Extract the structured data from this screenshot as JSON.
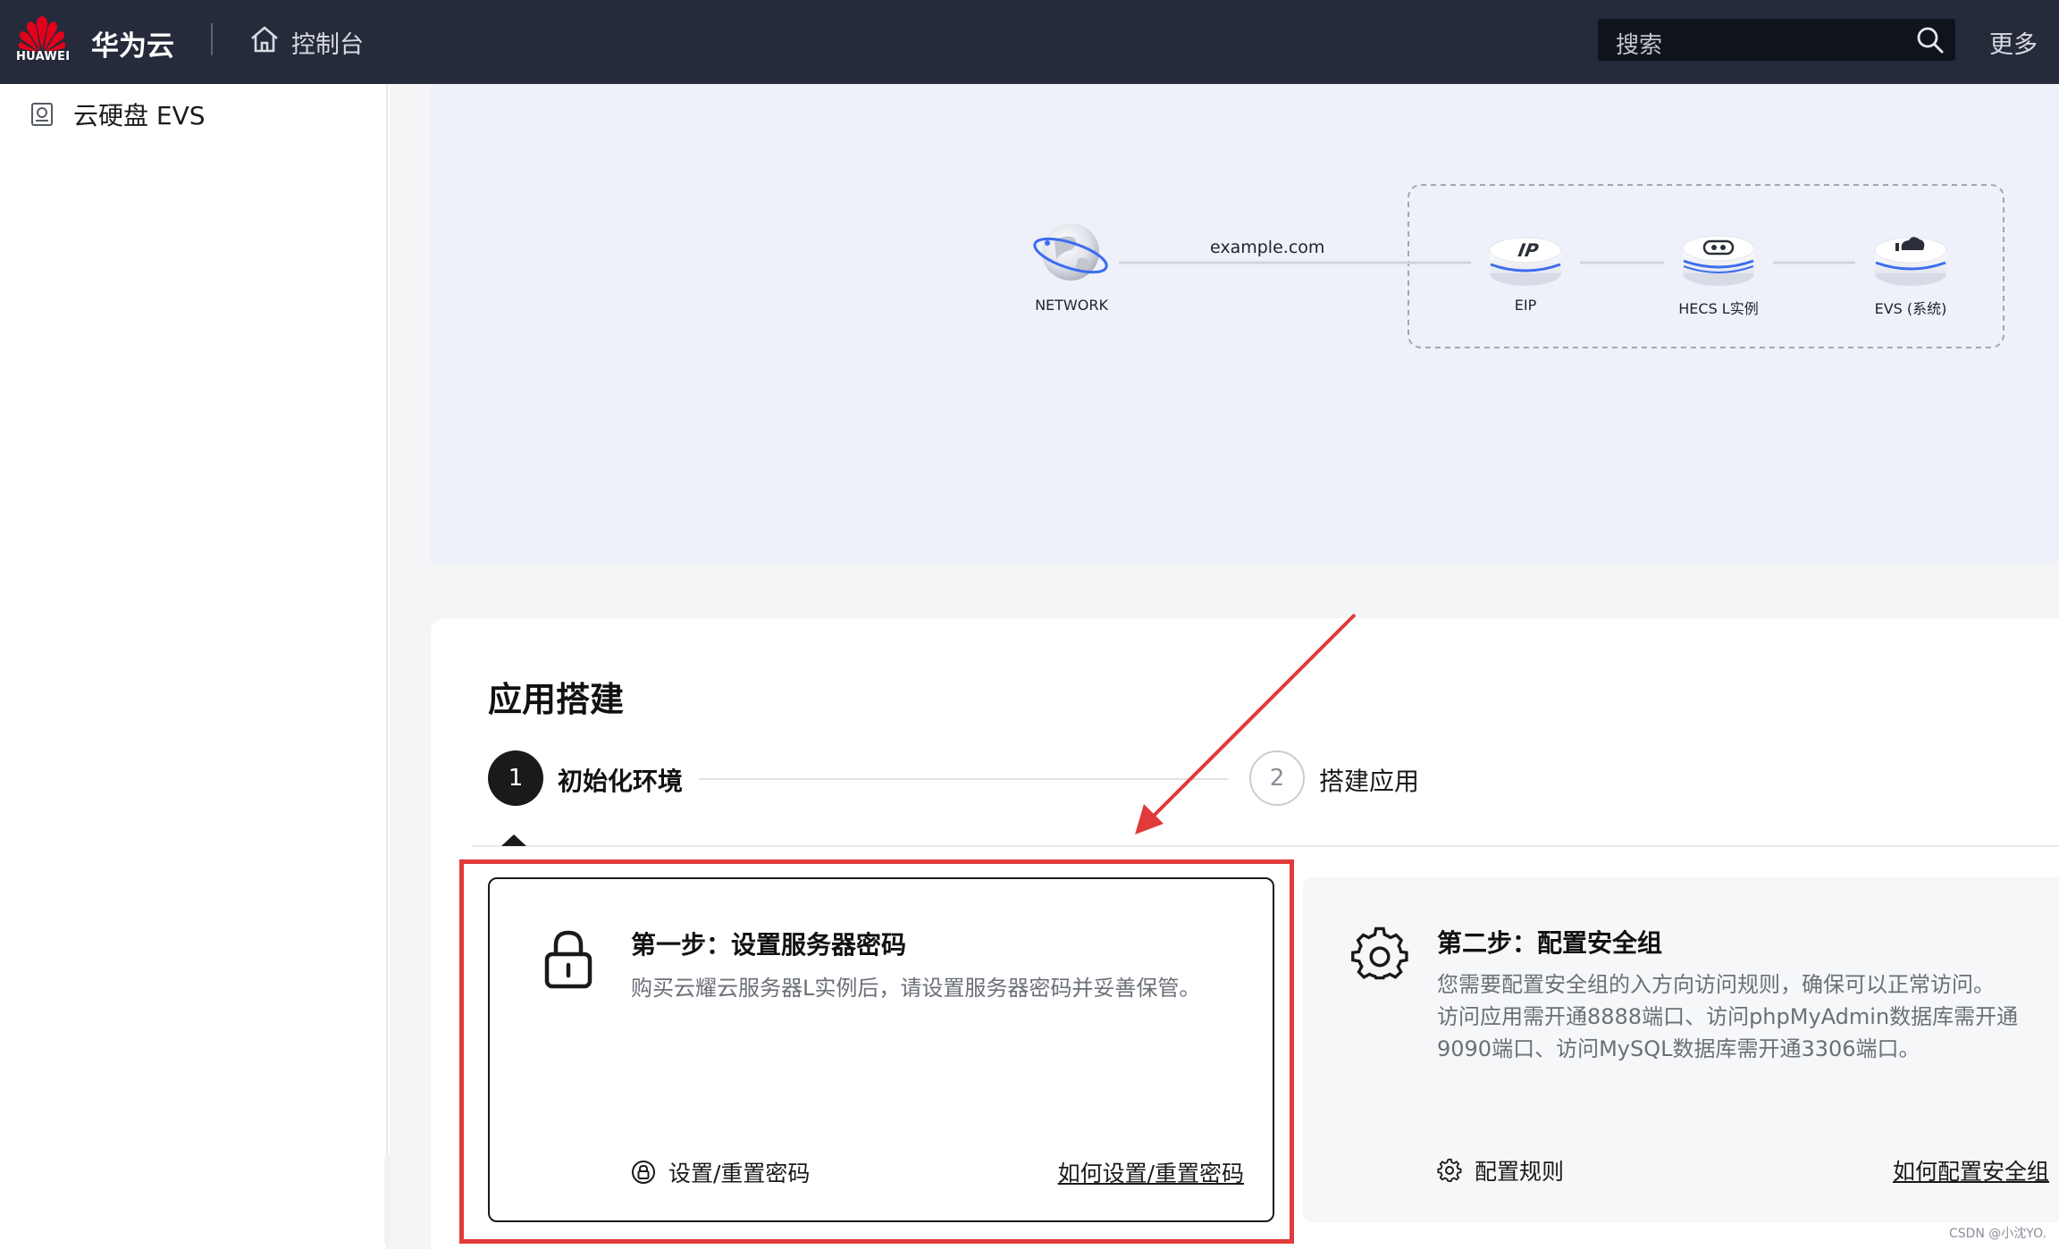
{
  "header": {
    "logo_text": "HUAWEI",
    "brand": "华为云",
    "console_label": "控制台",
    "search_placeholder": "搜索",
    "more_label": "更多"
  },
  "sidebar": {
    "items": [
      {
        "label": "云硬盘 EVS",
        "icon": "disk-icon"
      }
    ]
  },
  "topology": {
    "nodes": [
      {
        "label": "NETWORK",
        "icon": "globe-icon"
      },
      {
        "label": "EIP",
        "icon": "ip-node-icon"
      },
      {
        "label": "HECS L实例",
        "icon": "server-node-icon"
      },
      {
        "label": "EVS (系统)",
        "icon": "disk-node-icon"
      }
    ],
    "link_label": "example.com"
  },
  "app_setup": {
    "title": "应用搭建",
    "steps": [
      {
        "number": "1",
        "label": "初始化环境",
        "active": true
      },
      {
        "number": "2",
        "label": "搭建应用",
        "active": false
      }
    ],
    "cards": [
      {
        "title": "第一步：设置服务器密码",
        "description": "购买云耀云服务器L实例后，请设置服务器密码并妥善保管。",
        "action_label": "设置/重置密码",
        "help_link": "如何设置/重置密码",
        "icon": "lock-icon"
      },
      {
        "title": "第二步：配置安全组",
        "description_lines": [
          "您需要配置安全组的入方向访问规则，确保可以正常访问。",
          "访问应用需开通8888端口、访问phpMyAdmin数据库需开通",
          "9090端口、访问MySQL数据库需开通3306端口。"
        ],
        "action_label": "配置规则",
        "help_link": "如何配置安全组",
        "icon": "gear-icon"
      }
    ]
  },
  "watermark": "CSDN @小沈YO.",
  "colors": {
    "header_bg": "#252b3a",
    "highlight_red": "#e23a3a",
    "topology_bg": "#eef1fa",
    "node_blue": "#3d6cf0"
  }
}
